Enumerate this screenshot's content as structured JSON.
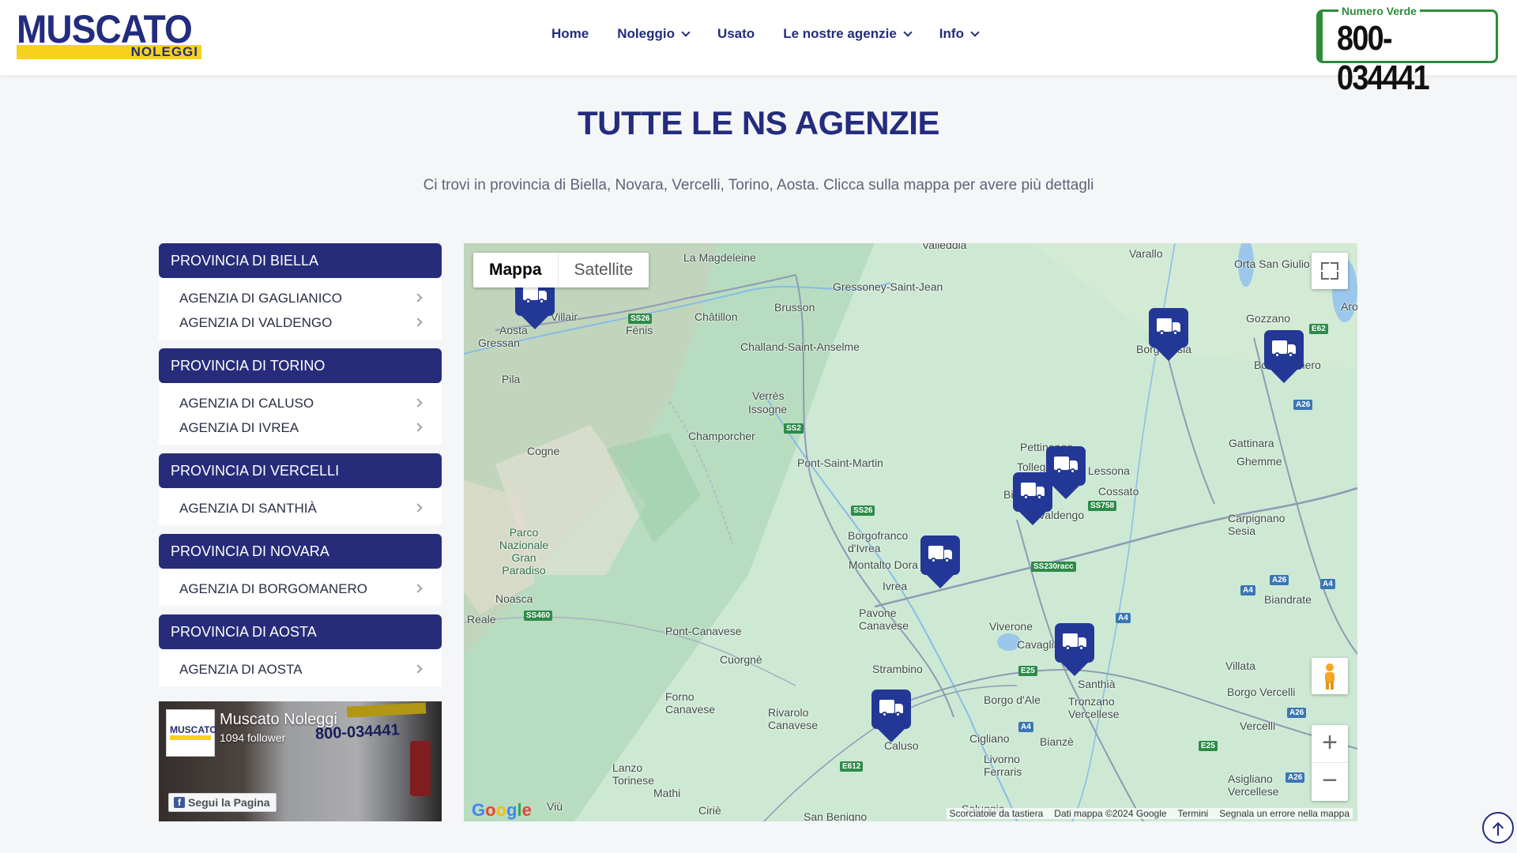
{
  "header": {
    "logo_main": "MUSCATO",
    "logo_sub": "NOLEGGI",
    "nav": [
      {
        "label": "Home",
        "has_dropdown": false
      },
      {
        "label": "Noleggio",
        "has_dropdown": true
      },
      {
        "label": "Usato",
        "has_dropdown": false
      },
      {
        "label": "Le nostre agenzie",
        "has_dropdown": true
      },
      {
        "label": "Info",
        "has_dropdown": true
      }
    ],
    "phone_label": "Numero Verde",
    "phone_number": "800-034441"
  },
  "page": {
    "title": "TUTTE LE NS AGENZIE",
    "subtitle": "Ci trovi in provincia di Biella, Novara, Vercelli, Torino, Aosta. Clicca sulla mappa per avere più dettagli"
  },
  "provinces": [
    {
      "name": "PROVINCIA DI BIELLA",
      "agencies": [
        "AGENZIA DI GAGLIANICO",
        "AGENZIA DI VALDENGO"
      ]
    },
    {
      "name": "PROVINCIA DI TORINO",
      "agencies": [
        "AGENZIA DI CALUSO",
        "AGENZIA DI IVREA"
      ]
    },
    {
      "name": "PROVINCIA DI VERCELLI",
      "agencies": [
        "AGENZIA DI SANTHIÀ"
      ]
    },
    {
      "name": "PROVINCIA DI NOVARA",
      "agencies": [
        "AGENZIA DI BORGOMANERO"
      ]
    },
    {
      "name": "PROVINCIA DI AOSTA",
      "agencies": [
        "AGENZIA DI AOSTA"
      ]
    }
  ],
  "facebook": {
    "page_name": "Muscato Noleggi",
    "followers": "1094 follower",
    "follow_button": "Segui la Pagina",
    "van_text": "800-034441",
    "logo_text": "MUSCATO",
    "logo_sub": "NOLEGGI"
  },
  "map": {
    "type_options": [
      "Mappa",
      "Satellite"
    ],
    "active_type": "Mappa",
    "labels": [
      "Valleddia",
      "La Magdeleine",
      "Varallo",
      "Orta San Giulio",
      "Gressoney-Saint-Jean",
      "Brusson",
      "Châtillon",
      "Villair",
      "Fénis",
      "Aosta",
      "Gressan",
      "Challand-Saint-Anselme",
      "Gozzano",
      "Borgosesia",
      "Borgomanero",
      "Arona",
      "Pila",
      "Verrès",
      "Issogne",
      "Champorcher",
      "Cogne",
      "Pont-Saint-Martin",
      "Pettinengo",
      "Tollegno",
      "Lessona",
      "Cossato",
      "Valdengo",
      "Biella",
      "Gattinara",
      "Ghemme",
      "Parco Nazionale Gran Paradiso",
      "Borgofranco d'Ivrea",
      "Montalto Dora",
      "Carpignano Sesia",
      "Ivrea",
      "Noasca",
      "Biandrate",
      "Reale",
      "Pavone Canavese",
      "Pont-Canavese",
      "Viverone",
      "Cavaglià",
      "Villata",
      "Cuorgnè",
      "Strambino",
      "Santhià",
      "Borgo Vercelli",
      "Borgo d'Ale",
      "Tronzano Vercellese",
      "Forno Canavese",
      "Rivarolo Canavese",
      "Caluso",
      "Cigliano",
      "Bianzè",
      "Livorno Ferraris",
      "Vercelli",
      "Lanzo Torinese",
      "Mathi",
      "Asigliano Vercellese",
      "Viù",
      "Ciriè",
      "San Benigno",
      "Saluggia"
    ],
    "road_tags": [
      "SS26",
      "SS26",
      "SS2",
      "SS758",
      "SS230racc",
      "SS460",
      "A4",
      "A4",
      "A4",
      "A26",
      "A26",
      "A26",
      "A26",
      "E25",
      "E25",
      "E62",
      "E612",
      "A4"
    ],
    "footer": [
      "Scorciatoie da tastiera",
      "Dati mappa ©2024 Google",
      "Termini",
      "Segnala un errore nella mappa"
    ],
    "google_logo": "Google",
    "zoom_in": "+",
    "zoom_out": "−"
  },
  "colors": {
    "brand_blue": "#232c7d",
    "brand_yellow": "#f6d21c",
    "province_header": "#262c7a",
    "marker": "#233896",
    "phone_green": "#2e8b3a"
  }
}
